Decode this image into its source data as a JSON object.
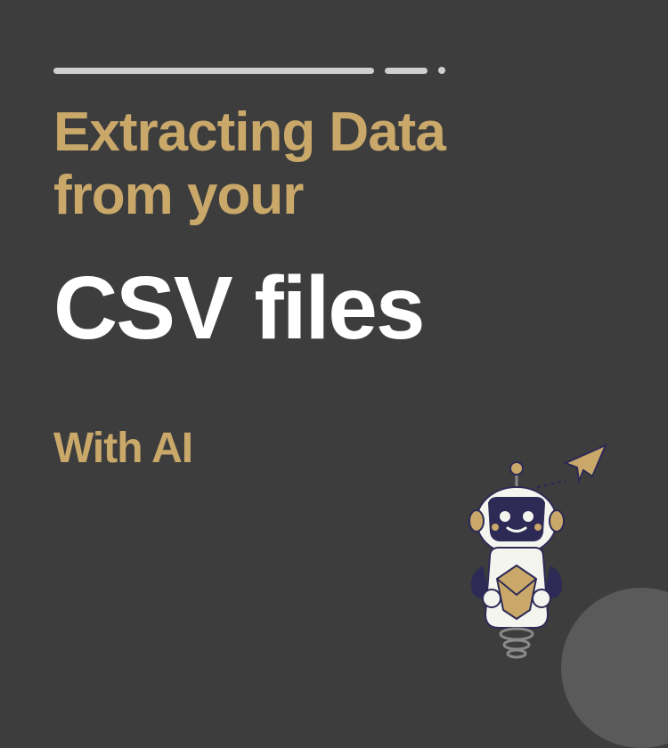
{
  "title": {
    "line1": "Extracting Data",
    "line2": "from your",
    "emphasis": "CSV files",
    "subtitle": "With AI"
  }
}
